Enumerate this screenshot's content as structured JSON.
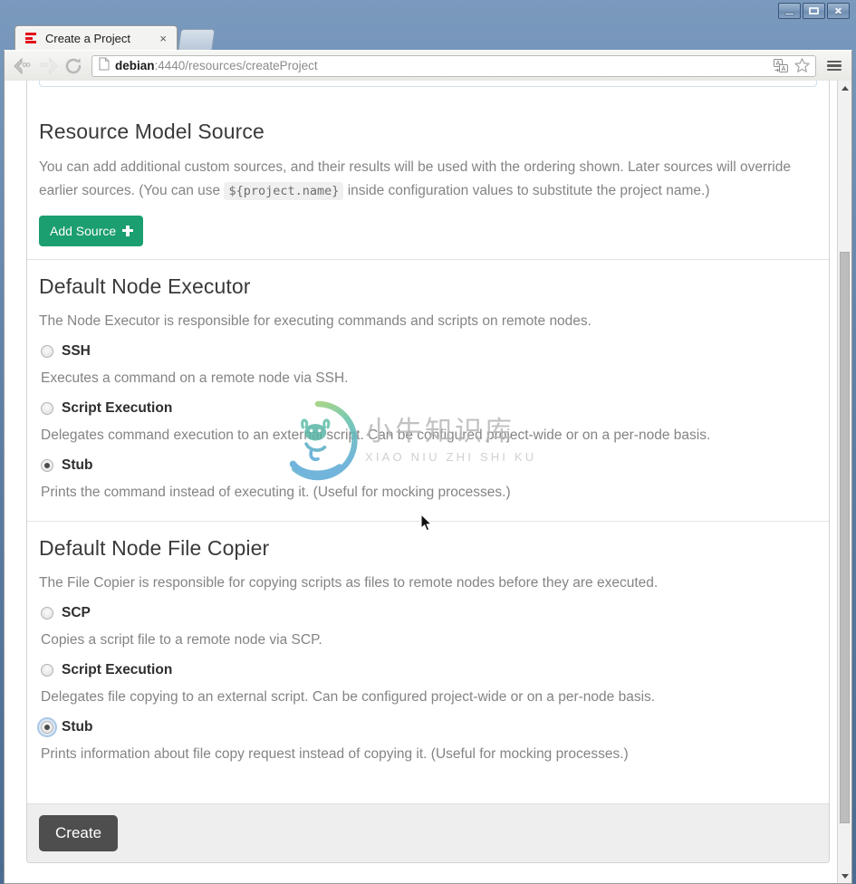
{
  "window": {
    "controls": [
      {
        "name": "minimize",
        "label": "–"
      },
      {
        "name": "maximize",
        "label": "□"
      },
      {
        "name": "close",
        "label": "✕"
      }
    ]
  },
  "browser": {
    "tab": {
      "title": "Create a Project",
      "close_label": "×",
      "favicon": "rundeck-logo-icon"
    },
    "new_tab_label": "",
    "nav": {
      "back_icon": "back-arrow-icon",
      "forward_icon": "forward-arrow-icon",
      "reload_icon": "reload-icon"
    },
    "url": {
      "host": "debian",
      "path": ":4440/resources/createProject",
      "page_icon": "page-document-icon",
      "translate_icon": "translate-icon",
      "bookmark_icon": "star-bookmark-icon"
    },
    "menu_icon": "hamburger-menu-icon"
  },
  "page": {
    "sections": [
      {
        "id": "resource-model-source",
        "title": "Resource Model Source",
        "desc_part1": "You can add additional custom sources, and their results will be used with the ordering shown. Later sources will override earlier sources. (You can use ",
        "desc_code": "${project.name}",
        "desc_part2": " inside configuration values to substitute the project name.)",
        "button_label": "Add Source"
      },
      {
        "id": "default-node-executor",
        "title": "Default Node Executor",
        "desc": "The Node Executor is responsible for executing commands and scripts on remote nodes.",
        "options": [
          {
            "label": "SSH",
            "desc": "Executes a command on a remote node via SSH.",
            "checked": false,
            "focused": false
          },
          {
            "label": "Script Execution",
            "desc": "Delegates command execution to an external script. Can be configured project-wide or on a per-node basis.",
            "checked": false,
            "focused": false
          },
          {
            "label": "Stub",
            "desc": "Prints the command instead of executing it. (Useful for mocking processes.)",
            "checked": true,
            "focused": false
          }
        ]
      },
      {
        "id": "default-node-file-copier",
        "title": "Default Node File Copier",
        "desc": "The File Copier is responsible for copying scripts as files to remote nodes before they are executed.",
        "options": [
          {
            "label": "SCP",
            "desc": "Copies a script file to a remote node via SCP.",
            "checked": false,
            "focused": false
          },
          {
            "label": "Script Execution",
            "desc": "Delegates file copying to an external script. Can be configured project-wide or on a per-node basis.",
            "checked": false,
            "focused": false
          },
          {
            "label": "Stub",
            "desc": "Prints information about file copy request instead of copying it. (Useful for mocking processes.)",
            "checked": true,
            "focused": true
          }
        ]
      }
    ],
    "footer": {
      "create_label": "Create"
    }
  },
  "watermark": {
    "chinese": "小牛知识库",
    "pinyin": "XIAO NIU ZHI SHI KU",
    "logo": "bull-circle-logo-icon"
  },
  "colors": {
    "accent_green": "#1b9e70",
    "button_dark": "#4e4e4e",
    "brand_red": "#e3121a",
    "text_muted": "#848484"
  }
}
